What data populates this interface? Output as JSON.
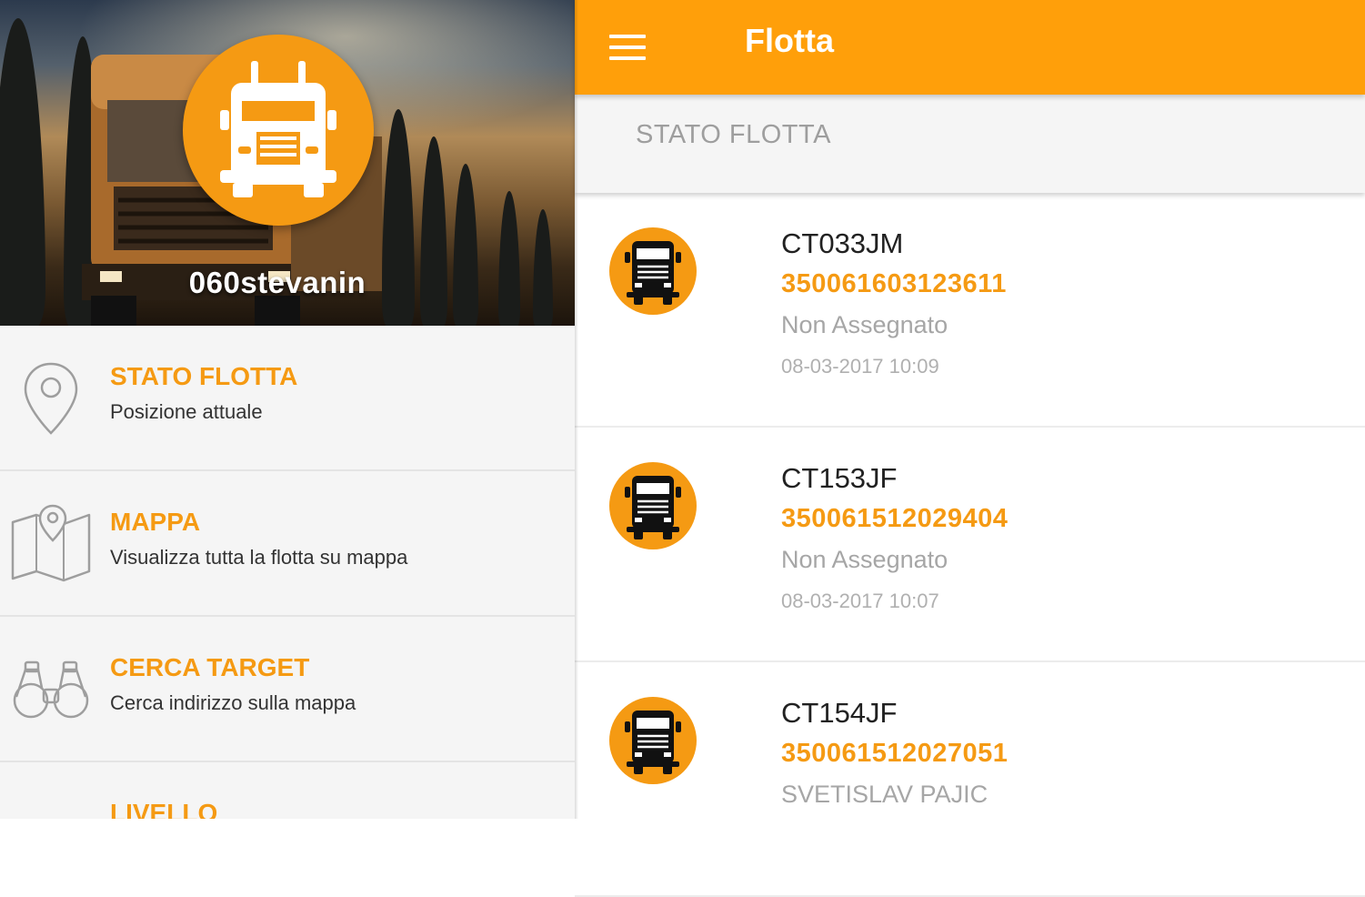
{
  "drawer": {
    "username": "060stevanin",
    "items": [
      {
        "title": "STATO FLOTTA",
        "subtitle": "Posizione attuale",
        "icon": "location-pin-icon"
      },
      {
        "title": "MAPPA",
        "subtitle": "Visualizza tutta la flotta su mappa",
        "icon": "map-icon"
      },
      {
        "title": "CERCA TARGET",
        "subtitle": "Cerca indirizzo sulla mappa",
        "icon": "binoculars-icon"
      },
      {
        "title": "LIVELLO",
        "subtitle": "",
        "icon": "gauge-icon"
      }
    ]
  },
  "appbar": {
    "title": "Flotta",
    "menu_icon": "hamburger-menu-icon"
  },
  "section": {
    "title": "STATO FLOTTA"
  },
  "vehicles": [
    {
      "plate": "CT033JM",
      "imei": "350061603123611",
      "driver": "Non Assegnato",
      "timestamp": "08-03-2017 10:09"
    },
    {
      "plate": "CT153JF",
      "imei": "350061512029404",
      "driver": "Non Assegnato",
      "timestamp": "08-03-2017 10:07"
    },
    {
      "plate": "CT154JF",
      "imei": "350061512027051",
      "driver": "SVETISLAV PAJIC",
      "timestamp": ""
    }
  ],
  "colors": {
    "accent": "#f59a13",
    "appbar": "#ff9f0a",
    "drawer_bg": "#f5f5f5"
  }
}
